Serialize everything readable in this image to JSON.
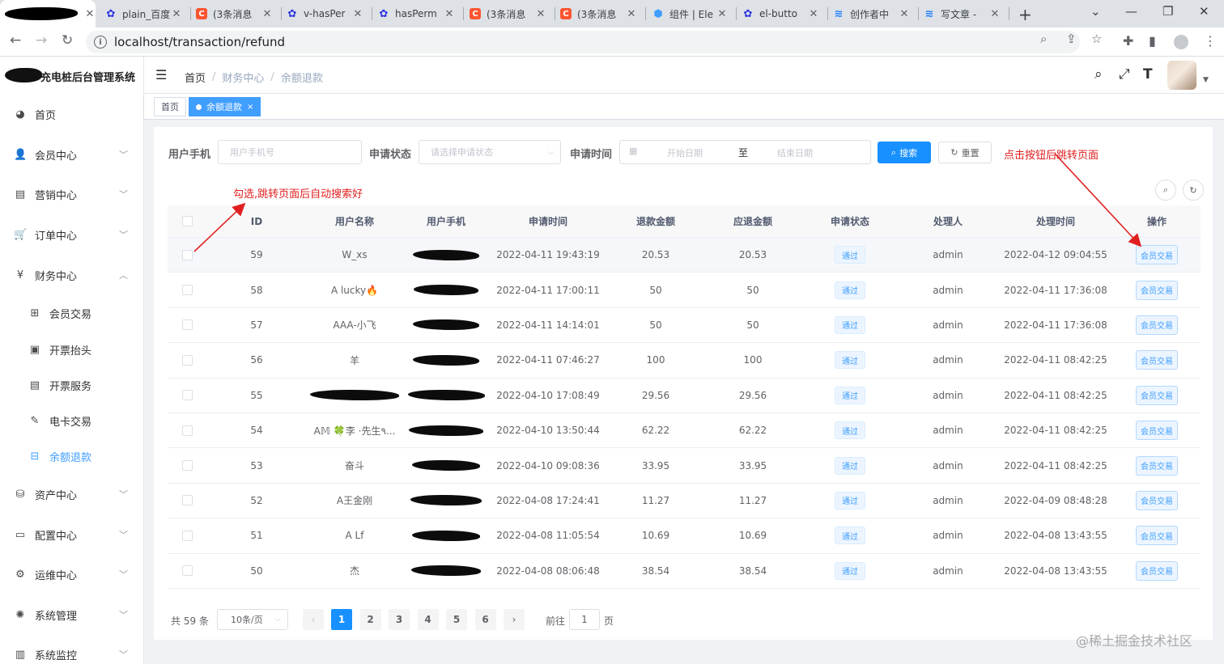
{
  "browser": {
    "tabs": [
      {
        "title": "",
        "icon": "blurred-favicon-icon",
        "color": "#000000"
      },
      {
        "title": "plain_百度",
        "icon": "baidu-paw-icon",
        "color": "#2932e1"
      },
      {
        "title": "(3条消息",
        "icon": "csdn-c-icon",
        "color": "#fc5531"
      },
      {
        "title": "v-hasPer",
        "icon": "baidu-paw-icon",
        "color": "#2932e1"
      },
      {
        "title": "hasPerm",
        "icon": "baidu-paw-icon",
        "color": "#2932e1"
      },
      {
        "title": "(3条消息",
        "icon": "csdn-c-icon",
        "color": "#fc5531"
      },
      {
        "title": "(3条消息",
        "icon": "csdn-c-icon",
        "color": "#fc5531"
      },
      {
        "title": "组件 | Ele",
        "icon": "element-hex-icon",
        "color": "#409eff"
      },
      {
        "title": "el-butto",
        "icon": "baidu-paw-icon",
        "color": "#2932e1"
      },
      {
        "title": "创作者中",
        "icon": "juejin-icon",
        "color": "#1e80ff"
      },
      {
        "title": "写文章 -",
        "icon": "juejin-icon",
        "color": "#1e80ff"
      }
    ],
    "url": "localhost/transaction/refund"
  },
  "sidebar": {
    "title": "充电桩后台管理系统",
    "items": [
      {
        "label": "首页",
        "icon": "dashboard-icon",
        "type": "top",
        "arrow": ""
      },
      {
        "label": "会员中心",
        "icon": "user-icon",
        "type": "top",
        "arrow": "down"
      },
      {
        "label": "营销中心",
        "icon": "marketing-icon",
        "type": "top",
        "arrow": "down"
      },
      {
        "label": "订单中心",
        "icon": "cart-icon",
        "type": "top",
        "arrow": "down"
      },
      {
        "label": "财务中心",
        "icon": "yen-icon",
        "type": "top",
        "arrow": "up"
      },
      {
        "label": "会员交易",
        "icon": "transaction-icon",
        "type": "sub",
        "arrow": ""
      },
      {
        "label": "开票抬头",
        "icon": "invoice-title-icon",
        "type": "sub",
        "arrow": ""
      },
      {
        "label": "开票服务",
        "icon": "invoice-service-icon",
        "type": "sub",
        "arrow": ""
      },
      {
        "label": "电卡交易",
        "icon": "card-edit-icon",
        "type": "sub",
        "arrow": ""
      },
      {
        "label": "余额退款",
        "icon": "refund-icon",
        "type": "sub",
        "arrow": "",
        "active": true
      },
      {
        "label": "资产中心",
        "icon": "database-icon",
        "type": "top",
        "arrow": "down"
      },
      {
        "label": "配置中心",
        "icon": "monitor-icon",
        "type": "top",
        "arrow": "down"
      },
      {
        "label": "运维中心",
        "icon": "tools-icon",
        "type": "top",
        "arrow": "down"
      },
      {
        "label": "系统管理",
        "icon": "settings-icon",
        "type": "top",
        "arrow": "down"
      },
      {
        "label": "系统监控",
        "icon": "monitor-chart-icon",
        "type": "top",
        "arrow": "down"
      }
    ]
  },
  "header": {
    "breadcrumb": {
      "home": "首页",
      "parent": "财务中心",
      "current": "余额退款"
    }
  },
  "tags": {
    "home": "首页",
    "active": "余额退款"
  },
  "filters": {
    "phone_label": "用户手机",
    "phone_placeholder": "用户手机号",
    "status_label": "申请状态",
    "status_placeholder": "请选择申请状态",
    "time_label": "申请时间",
    "start_placeholder": "开始日期",
    "range_sep": "至",
    "end_placeholder": "结束日期",
    "search_label": "搜索",
    "reset_label": "重置"
  },
  "annotations": {
    "checkbox_note": "勾选,跳转页面后自动搜索好",
    "button_note": "点击按钮后跳转页面",
    "color": "#e02020"
  },
  "table": {
    "headers": [
      "ID",
      "用户名称",
      "用户手机",
      "申请时间",
      "退款金额",
      "应退金额",
      "申请状态",
      "处理人",
      "处理时间",
      "操作"
    ],
    "rows": [
      {
        "id": "59",
        "name": "W_xs",
        "name_redacted": false,
        "apply_time": "2022-04-11 19:43:19",
        "refund": "20.53",
        "due": "20.53",
        "status": "通过",
        "handler": "admin",
        "handle_time": "2022-04-12 09:04:55",
        "action": "会员交易"
      },
      {
        "id": "58",
        "name": "A lucky🔥",
        "name_redacted": false,
        "apply_time": "2022-04-11 17:00:11",
        "refund": "50",
        "due": "50",
        "status": "通过",
        "handler": "admin",
        "handle_time": "2022-04-11 17:36:08",
        "action": "会员交易"
      },
      {
        "id": "57",
        "name": "AAA-小飞",
        "name_redacted": false,
        "apply_time": "2022-04-11 14:14:01",
        "refund": "50",
        "due": "50",
        "status": "通过",
        "handler": "admin",
        "handle_time": "2022-04-11 17:36:08",
        "action": "会员交易"
      },
      {
        "id": "56",
        "name": "羊",
        "name_redacted": false,
        "apply_time": "2022-04-11 07:46:27",
        "refund": "100",
        "due": "100",
        "status": "通过",
        "handler": "admin",
        "handle_time": "2022-04-11 08:42:25",
        "action": "会员交易"
      },
      {
        "id": "55",
        "name": "",
        "name_redacted": true,
        "apply_time": "2022-04-10 17:08:49",
        "refund": "29.56",
        "due": "29.56",
        "status": "通过",
        "handler": "admin",
        "handle_time": "2022-04-11 08:42:25",
        "action": "会员交易"
      },
      {
        "id": "54",
        "name": "A𝕄 🍀李 ·先生٩...",
        "name_redacted": false,
        "apply_time": "2022-04-10 13:50:44",
        "refund": "62.22",
        "due": "62.22",
        "status": "通过",
        "handler": "admin",
        "handle_time": "2022-04-11 08:42:25",
        "action": "会员交易"
      },
      {
        "id": "53",
        "name": "奋斗",
        "name_redacted": false,
        "apply_time": "2022-04-10 09:08:36",
        "refund": "33.95",
        "due": "33.95",
        "status": "通过",
        "handler": "admin",
        "handle_time": "2022-04-11 08:42:25",
        "action": "会员交易"
      },
      {
        "id": "52",
        "name": "A王金刚",
        "name_redacted": false,
        "apply_time": "2022-04-08 17:24:41",
        "refund": "11.27",
        "due": "11.27",
        "status": "通过",
        "handler": "admin",
        "handle_time": "2022-04-09 08:48:28",
        "action": "会员交易"
      },
      {
        "id": "51",
        "name": "A Lf",
        "name_redacted": false,
        "apply_time": "2022-04-08 11:05:54",
        "refund": "10.69",
        "due": "10.69",
        "status": "通过",
        "handler": "admin",
        "handle_time": "2022-04-08 13:43:55",
        "action": "会员交易"
      },
      {
        "id": "50",
        "name": "杰",
        "name_redacted": false,
        "apply_time": "2022-04-08 08:06:48",
        "refund": "38.54",
        "due": "38.54",
        "status": "通过",
        "handler": "admin",
        "handle_time": "2022-04-08 13:43:55",
        "action": "会员交易"
      }
    ]
  },
  "pagination": {
    "total": "共 59 条",
    "page_size": "10条/页",
    "pages": [
      "1",
      "2",
      "3",
      "4",
      "5",
      "6"
    ],
    "current": "1",
    "goto_prefix": "前往",
    "goto_value": "1",
    "goto_suffix": "页"
  },
  "watermark": "@稀土掘金技术社区",
  "colors": {
    "accent": "#409eff",
    "primary_button": "#1890ff",
    "annotation": "#e02020"
  }
}
